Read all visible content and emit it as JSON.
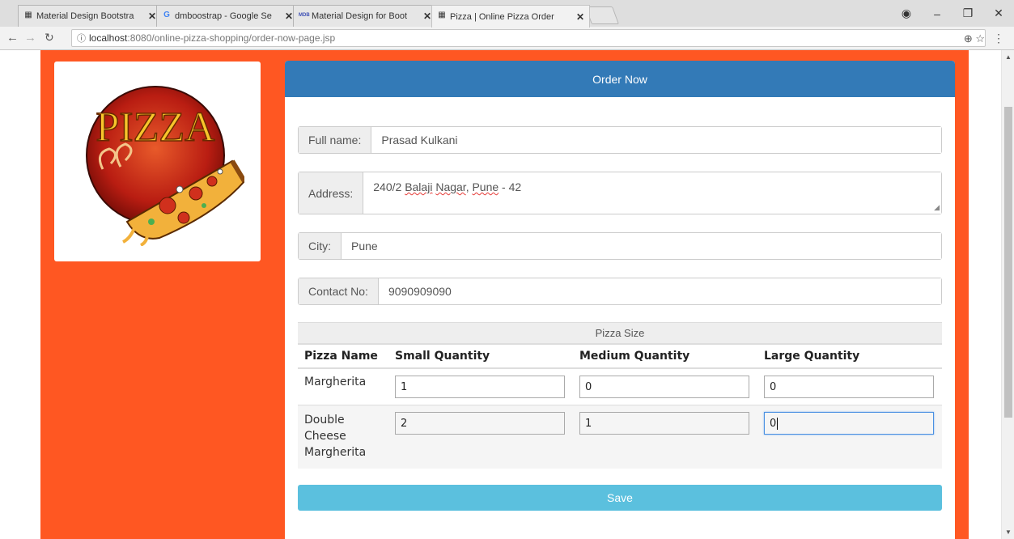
{
  "browser": {
    "tabs": [
      {
        "title": "Material Design Bootstra",
        "favicon": "page-icon"
      },
      {
        "title": "dmboostrap - Google Se",
        "favicon": "google-icon"
      },
      {
        "title": "Material Design for Boot",
        "favicon": "mdb-icon"
      },
      {
        "title": "Pizza | Online Pizza Order",
        "favicon": "page-icon",
        "active": true
      }
    ],
    "tab_close": "✕",
    "url_host": "localhost",
    "url_path": ":8080/online-pizza-shopping/order-now-page.jsp",
    "favicon_mdb": "MDB"
  },
  "panel": {
    "heading": "Order Now"
  },
  "form": {
    "fullname_label": "Full name:",
    "fullname_value": "Prasad Kulkani",
    "address_label": "Address:",
    "address_num": "240/2 ",
    "address_word1": "Balaji",
    "address_word2": "Nagar",
    "address_comma1": ", ",
    "address_word3": "Pune",
    "address_rest": " - 42",
    "city_label": "City:",
    "city_value": "Pune",
    "contact_label": "Contact No:",
    "contact_value": "9090909090"
  },
  "sizes": {
    "header": "Pizza Size",
    "columns": [
      "Pizza Name",
      "Small Quantity",
      "Medium Quantity",
      "Large Quantity"
    ],
    "rows": [
      {
        "name": "Margherita",
        "small": "1",
        "medium": "0",
        "large": "0"
      },
      {
        "name": "Double Cheese Margherita",
        "small": "2",
        "medium": "1",
        "large": "0"
      }
    ]
  },
  "save_label": "Save",
  "logo": {
    "text": "PIZZA"
  },
  "colors": {
    "page_bg": "#ff5722",
    "panel_heading": "#337ab7",
    "save_button": "#5bc0de"
  }
}
